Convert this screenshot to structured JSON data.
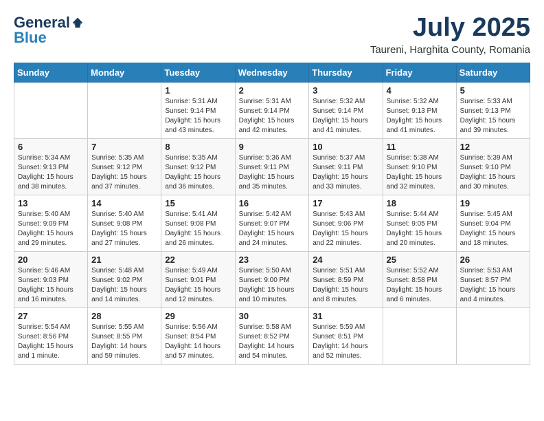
{
  "header": {
    "logo_general": "General",
    "logo_blue": "Blue",
    "month_title": "July 2025",
    "subtitle": "Taureni, Harghita County, Romania"
  },
  "weekdays": [
    "Sunday",
    "Monday",
    "Tuesday",
    "Wednesday",
    "Thursday",
    "Friday",
    "Saturday"
  ],
  "weeks": [
    [
      {
        "day": "",
        "info": ""
      },
      {
        "day": "",
        "info": ""
      },
      {
        "day": "1",
        "info": "Sunrise: 5:31 AM\nSunset: 9:14 PM\nDaylight: 15 hours\nand 43 minutes."
      },
      {
        "day": "2",
        "info": "Sunrise: 5:31 AM\nSunset: 9:14 PM\nDaylight: 15 hours\nand 42 minutes."
      },
      {
        "day": "3",
        "info": "Sunrise: 5:32 AM\nSunset: 9:14 PM\nDaylight: 15 hours\nand 41 minutes."
      },
      {
        "day": "4",
        "info": "Sunrise: 5:32 AM\nSunset: 9:13 PM\nDaylight: 15 hours\nand 41 minutes."
      },
      {
        "day": "5",
        "info": "Sunrise: 5:33 AM\nSunset: 9:13 PM\nDaylight: 15 hours\nand 39 minutes."
      }
    ],
    [
      {
        "day": "6",
        "info": "Sunrise: 5:34 AM\nSunset: 9:13 PM\nDaylight: 15 hours\nand 38 minutes."
      },
      {
        "day": "7",
        "info": "Sunrise: 5:35 AM\nSunset: 9:12 PM\nDaylight: 15 hours\nand 37 minutes."
      },
      {
        "day": "8",
        "info": "Sunrise: 5:35 AM\nSunset: 9:12 PM\nDaylight: 15 hours\nand 36 minutes."
      },
      {
        "day": "9",
        "info": "Sunrise: 5:36 AM\nSunset: 9:11 PM\nDaylight: 15 hours\nand 35 minutes."
      },
      {
        "day": "10",
        "info": "Sunrise: 5:37 AM\nSunset: 9:11 PM\nDaylight: 15 hours\nand 33 minutes."
      },
      {
        "day": "11",
        "info": "Sunrise: 5:38 AM\nSunset: 9:10 PM\nDaylight: 15 hours\nand 32 minutes."
      },
      {
        "day": "12",
        "info": "Sunrise: 5:39 AM\nSunset: 9:10 PM\nDaylight: 15 hours\nand 30 minutes."
      }
    ],
    [
      {
        "day": "13",
        "info": "Sunrise: 5:40 AM\nSunset: 9:09 PM\nDaylight: 15 hours\nand 29 minutes."
      },
      {
        "day": "14",
        "info": "Sunrise: 5:40 AM\nSunset: 9:08 PM\nDaylight: 15 hours\nand 27 minutes."
      },
      {
        "day": "15",
        "info": "Sunrise: 5:41 AM\nSunset: 9:08 PM\nDaylight: 15 hours\nand 26 minutes."
      },
      {
        "day": "16",
        "info": "Sunrise: 5:42 AM\nSunset: 9:07 PM\nDaylight: 15 hours\nand 24 minutes."
      },
      {
        "day": "17",
        "info": "Sunrise: 5:43 AM\nSunset: 9:06 PM\nDaylight: 15 hours\nand 22 minutes."
      },
      {
        "day": "18",
        "info": "Sunrise: 5:44 AM\nSunset: 9:05 PM\nDaylight: 15 hours\nand 20 minutes."
      },
      {
        "day": "19",
        "info": "Sunrise: 5:45 AM\nSunset: 9:04 PM\nDaylight: 15 hours\nand 18 minutes."
      }
    ],
    [
      {
        "day": "20",
        "info": "Sunrise: 5:46 AM\nSunset: 9:03 PM\nDaylight: 15 hours\nand 16 minutes."
      },
      {
        "day": "21",
        "info": "Sunrise: 5:48 AM\nSunset: 9:02 PM\nDaylight: 15 hours\nand 14 minutes."
      },
      {
        "day": "22",
        "info": "Sunrise: 5:49 AM\nSunset: 9:01 PM\nDaylight: 15 hours\nand 12 minutes."
      },
      {
        "day": "23",
        "info": "Sunrise: 5:50 AM\nSunset: 9:00 PM\nDaylight: 15 hours\nand 10 minutes."
      },
      {
        "day": "24",
        "info": "Sunrise: 5:51 AM\nSunset: 8:59 PM\nDaylight: 15 hours\nand 8 minutes."
      },
      {
        "day": "25",
        "info": "Sunrise: 5:52 AM\nSunset: 8:58 PM\nDaylight: 15 hours\nand 6 minutes."
      },
      {
        "day": "26",
        "info": "Sunrise: 5:53 AM\nSunset: 8:57 PM\nDaylight: 15 hours\nand 4 minutes."
      }
    ],
    [
      {
        "day": "27",
        "info": "Sunrise: 5:54 AM\nSunset: 8:56 PM\nDaylight: 15 hours\nand 1 minute."
      },
      {
        "day": "28",
        "info": "Sunrise: 5:55 AM\nSunset: 8:55 PM\nDaylight: 14 hours\nand 59 minutes."
      },
      {
        "day": "29",
        "info": "Sunrise: 5:56 AM\nSunset: 8:54 PM\nDaylight: 14 hours\nand 57 minutes."
      },
      {
        "day": "30",
        "info": "Sunrise: 5:58 AM\nSunset: 8:52 PM\nDaylight: 14 hours\nand 54 minutes."
      },
      {
        "day": "31",
        "info": "Sunrise: 5:59 AM\nSunset: 8:51 PM\nDaylight: 14 hours\nand 52 minutes."
      },
      {
        "day": "",
        "info": ""
      },
      {
        "day": "",
        "info": ""
      }
    ]
  ]
}
